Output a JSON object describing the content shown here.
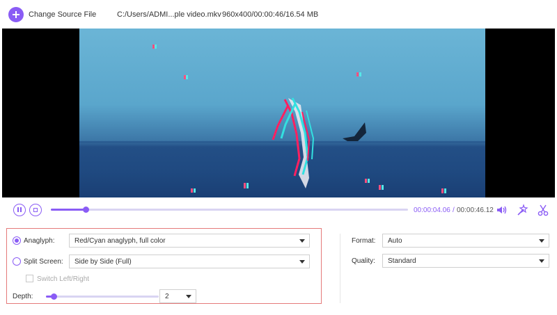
{
  "header": {
    "change_source_label": "Change Source File",
    "file_path": "C:/Users/ADMI...ple video.mkv",
    "file_meta": "960x400/00:00:46/16.54 MB",
    "icons": {
      "add": "plus-circle-icon"
    }
  },
  "player": {
    "current_time": "00:00:04.06",
    "separator": "/",
    "total_time": "00:00:46.12",
    "progress": 0.097,
    "icons": [
      "pause-icon",
      "stop-icon",
      "volume-icon",
      "magic-wand-icon",
      "scissors-icon"
    ]
  },
  "settings": {
    "anaglyph_label": "Anaglyph:",
    "anaglyph_value": "Red/Cyan anaglyph, full color",
    "anaglyph_checked": true,
    "split_screen_label": "Split Screen:",
    "split_screen_value": "Side by Side (Full)",
    "split_screen_checked": false,
    "switch_label": "Switch Left/Right",
    "depth_label": "Depth:",
    "depth_value": "2",
    "depth_level": 0.07
  },
  "output": {
    "format_label": "Format:",
    "format_value": "Auto",
    "quality_label": "Quality:",
    "quality_value": "Standard"
  },
  "colors": {
    "accent": "#8a5cf5",
    "highlight_border": "#e57a7a"
  }
}
